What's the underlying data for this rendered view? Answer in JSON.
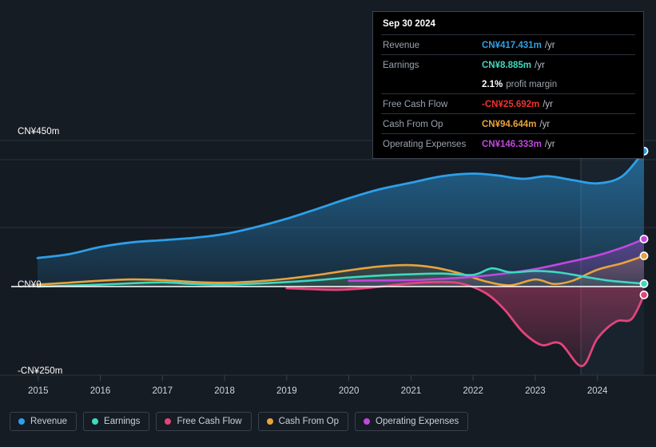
{
  "tooltip": {
    "date": "Sep 30 2024",
    "rows": [
      {
        "label": "Revenue",
        "value": "CN¥417.431m",
        "unit": "/yr",
        "color": "#2e9fe8"
      },
      {
        "label": "Earnings",
        "value": "CN¥8.885m",
        "unit": "/yr",
        "color": "#3fd8c0"
      },
      {
        "label": "",
        "value": "2.1%",
        "unit": "profit margin",
        "color": "#ffffff",
        "margin": true
      },
      {
        "label": "Free Cash Flow",
        "value": "-CN¥25.692m",
        "unit": "/yr",
        "color": "#f0322f"
      },
      {
        "label": "Cash From Op",
        "value": "CN¥94.644m",
        "unit": "/yr",
        "color": "#e8a33d"
      },
      {
        "label": "Operating Expenses",
        "value": "CN¥146.333m",
        "unit": "/yr",
        "color": "#c247e0"
      }
    ]
  },
  "axes": {
    "y_top_label": "CN¥450m",
    "y_zero_label": "CN¥0",
    "y_bottom_label": "-CN¥250m",
    "x_ticks": [
      "2015",
      "2016",
      "2017",
      "2018",
      "2019",
      "2020",
      "2021",
      "2022",
      "2023",
      "2024"
    ]
  },
  "legend": [
    {
      "label": "Revenue",
      "color": "#2e9fe8"
    },
    {
      "label": "Earnings",
      "color": "#3fd8c0"
    },
    {
      "label": "Free Cash Flow",
      "color": "#e0457b"
    },
    {
      "label": "Cash From Op",
      "color": "#e8a33d"
    },
    {
      "label": "Operating Expenses",
      "color": "#c247e0"
    }
  ],
  "chart_data": {
    "type": "area",
    "title": "",
    "xlabel": "",
    "ylabel": "CN¥",
    "ylim": [
      -250,
      450
    ],
    "yticks": [
      450,
      0,
      -250
    ],
    "x": [
      2015,
      2016,
      2017,
      2018,
      2019,
      2020,
      2021,
      2022,
      2023,
      2024,
      2024.75
    ],
    "grid": true,
    "legend_position": "bottom",
    "forecast_boundary": 2023.75,
    "series": [
      {
        "name": "Revenue",
        "color": "#2e9fe8",
        "x": [
          2014.99,
          2015.5,
          2016,
          2016.5,
          2017,
          2017.5,
          2018,
          2018.5,
          2019,
          2019.5,
          2020,
          2020.5,
          2021,
          2021.5,
          2022,
          2022.4,
          2022.8,
          2023.2,
          2023.6,
          2024,
          2024.4,
          2024.75
        ],
        "values": [
          88,
          100,
          122,
          136,
          143,
          150,
          162,
          183,
          209,
          240,
          272,
          300,
          320,
          340,
          348,
          342,
          332,
          340,
          328,
          318,
          340,
          417.431
        ]
      },
      {
        "name": "Earnings",
        "color": "#3fd8c0",
        "x": [
          2014.99,
          2015.5,
          2016,
          2016.5,
          2017,
          2017.5,
          2018,
          2018.5,
          2019,
          2019.5,
          2020,
          2020.5,
          2021,
          2021.5,
          2022,
          2022.3,
          2022.6,
          2023,
          2023.4,
          2023.8,
          2024.2,
          2024.75
        ],
        "values": [
          0,
          3,
          6,
          10,
          13,
          8,
          6,
          9,
          14,
          20,
          28,
          34,
          38,
          40,
          36,
          56,
          44,
          48,
          43,
          30,
          18,
          8.885
        ]
      },
      {
        "name": "Free Cash Flow",
        "color": "#e0457b",
        "x": [
          2019,
          2019.4,
          2019.8,
          2020.2,
          2020.6,
          2021,
          2021.4,
          2021.8,
          2022.2,
          2022.5,
          2022.8,
          2023.1,
          2023.4,
          2023.75,
          2024,
          2024.3,
          2024.55,
          2024.75
        ],
        "values": [
          -5,
          -8,
          -10,
          -6,
          2,
          10,
          14,
          10,
          -20,
          -70,
          -140,
          -180,
          -175,
          -245,
          -160,
          -108,
          -100,
          -25.692
        ]
      },
      {
        "name": "Cash From Op",
        "color": "#e8a33d",
        "x": [
          2014.99,
          2015.5,
          2016,
          2016.5,
          2017,
          2017.5,
          2018,
          2018.5,
          2019,
          2019.5,
          2020,
          2020.5,
          2021,
          2021.4,
          2021.8,
          2022.2,
          2022.6,
          2023,
          2023.3,
          2023.6,
          2024,
          2024.4,
          2024.75
        ],
        "values": [
          6,
          12,
          18,
          22,
          20,
          14,
          12,
          16,
          24,
          36,
          50,
          62,
          66,
          58,
          40,
          16,
          4,
          22,
          8,
          18,
          52,
          72,
          94.644
        ]
      },
      {
        "name": "Operating Expenses",
        "color": "#c247e0",
        "x": [
          2020,
          2020.5,
          2021,
          2021.5,
          2022,
          2022.5,
          2023,
          2023.5,
          2024,
          2024.4,
          2024.75
        ],
        "values": [
          18,
          19,
          20,
          24,
          30,
          40,
          54,
          74,
          96,
          120,
          146.333
        ]
      }
    ]
  }
}
